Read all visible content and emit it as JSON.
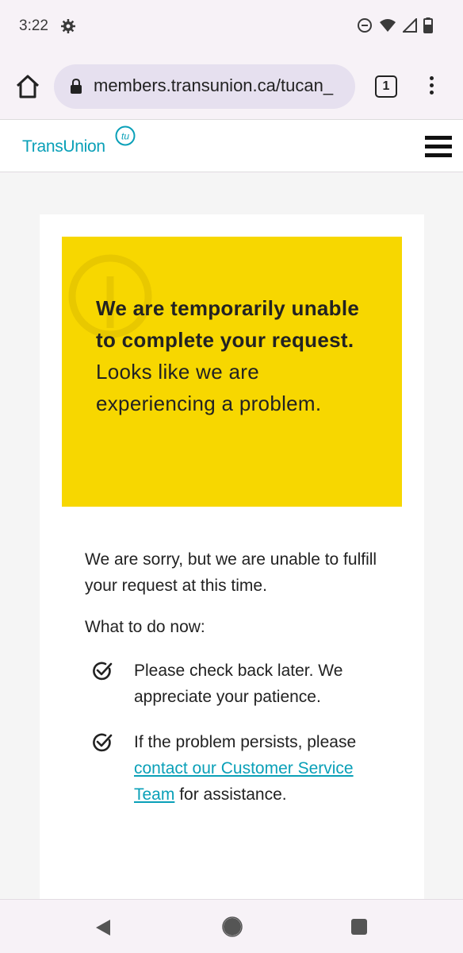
{
  "status_bar": {
    "time": "3:22"
  },
  "browser": {
    "url": "members.transunion.ca/tucan_",
    "tab_count": "1"
  },
  "header": {
    "logo": "TransUnion",
    "logo_mark": "tu"
  },
  "banner": {
    "bold_text": "We are temporarily unable to complete your request.",
    "regular_text": "Looks like we are experiencing a problem."
  },
  "content": {
    "intro": "We are sorry, but we are unable to fulfill your request at this time.",
    "todo_heading": "What to do now:",
    "item1": "Please check back later. We appreciate your patience.",
    "item2_before": "If the problem persists, please",
    "item2_link": "contact our Customer Service Team",
    "item2_after": "for assistance."
  },
  "colors": {
    "banner": "#f7d700",
    "brand": "#0aa0b8"
  }
}
